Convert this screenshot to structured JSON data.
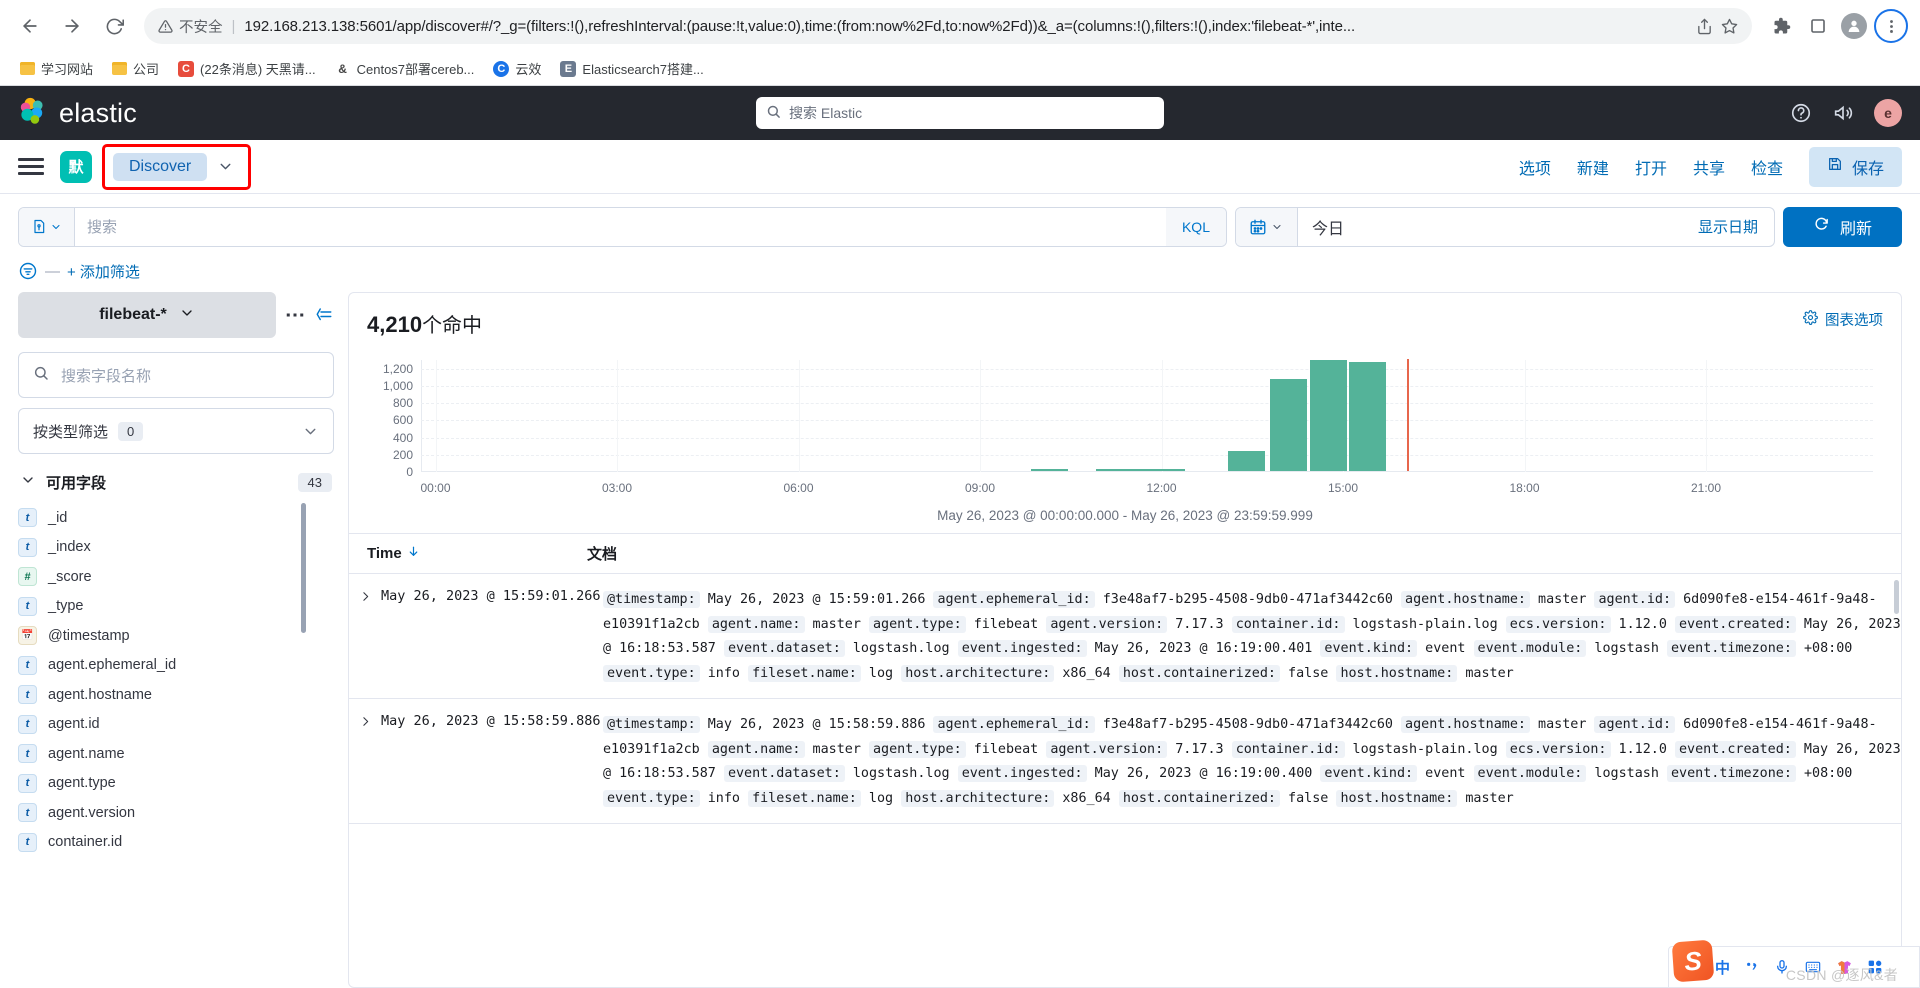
{
  "browser": {
    "back_icon": "back-arrow-icon",
    "forward_icon": "forward-arrow-icon",
    "reload_icon": "reload-icon",
    "insecure_label": "不安全",
    "url": "192.168.213.138:5601/app/discover#/?_g=(filters:!(),refreshInterval:(pause:!t,value:0),time:(from:now%2Fd,to:now%2Fd))&_a=(columns:!(),filters:!(),index:'filebeat-*',inte...",
    "bookmarks": [
      {
        "label": "学习网站",
        "type": "folder"
      },
      {
        "label": "公司",
        "type": "folder"
      },
      {
        "label": "(22条消息) 天黑请...",
        "type": "favicon",
        "glyph": "C",
        "color": "#e74c3c"
      },
      {
        "label": "Centos7部署cereb...",
        "type": "favicon",
        "glyph": "&",
        "color": "#ffffff"
      },
      {
        "label": "云效",
        "type": "favicon",
        "glyph": "C",
        "color": "#1a73e8"
      },
      {
        "label": "Elasticsearch7搭建...",
        "type": "favicon",
        "glyph": "E",
        "color": "#6b7a8f"
      }
    ]
  },
  "elastic_header": {
    "wordmark": "elastic",
    "search_placeholder": "搜索 Elastic",
    "search_icon": "search-icon",
    "help_icon": "help-circle-icon",
    "news_icon": "announcement-icon",
    "avatar_initial": "e"
  },
  "app_nav": {
    "menu_icon": "hamburger-menu-icon",
    "space_initial": "默",
    "current_app": "Discover",
    "chevron_icon": "chevron-down-icon",
    "links": [
      "选项",
      "新建",
      "打开",
      "共享",
      "检查"
    ],
    "save_label": "保存",
    "save_icon": "save-disk-icon",
    "highlight_color": "#ff0000"
  },
  "query_bar": {
    "saved_query_icon": "saved-query-icon",
    "search_placeholder": "搜索",
    "language_badge": "KQL",
    "calendar_icon": "calendar-icon",
    "date_value": "今日",
    "show_dates_label": "显示日期",
    "refresh_label": "刷新",
    "refresh_icon": "refresh-icon"
  },
  "filter_bar": {
    "filter_icon": "filter-icon",
    "dash": "—",
    "add_filter_label": "+ 添加筛选"
  },
  "sidebar": {
    "index_pattern": "filebeat-*",
    "index_chevron_icon": "chevron-down-icon",
    "more_icon": "more-horizontal-icon",
    "collapse_icon": "collapse-sidebar-icon",
    "field_search_placeholder": "搜索字段名称",
    "field_search_icon": "search-icon",
    "type_filter_label": "按类型筛选",
    "type_filter_count": "0",
    "available_fields_label": "可用字段",
    "available_fields_count": "43",
    "fields": [
      {
        "name": "_id",
        "type": "t"
      },
      {
        "name": "_index",
        "type": "t"
      },
      {
        "name": "_score",
        "type": "#"
      },
      {
        "name": "_type",
        "type": "t"
      },
      {
        "name": "@timestamp",
        "type": "date"
      },
      {
        "name": "agent.ephemeral_id",
        "type": "t"
      },
      {
        "name": "agent.hostname",
        "type": "t"
      },
      {
        "name": "agent.id",
        "type": "t"
      },
      {
        "name": "agent.name",
        "type": "t"
      },
      {
        "name": "agent.type",
        "type": "t"
      },
      {
        "name": "agent.version",
        "type": "t"
      },
      {
        "name": "container.id",
        "type": "t"
      }
    ]
  },
  "chart_panel": {
    "hits_count": "4,210",
    "hits_suffix": "个命中",
    "chart_options_label": "图表选项",
    "chart_options_icon": "gear-icon"
  },
  "chart_data": {
    "type": "bar",
    "title": "4,210 个命中",
    "xlabel": "",
    "ylabel": "",
    "ylim": [
      0,
      1300
    ],
    "yticks": [
      0,
      200,
      400,
      600,
      800,
      1000,
      1200
    ],
    "ytick_labels": [
      "0",
      "200",
      "400",
      "600",
      "800",
      "1,000",
      "1,200"
    ],
    "xticks": [
      "00:00",
      "03:00",
      "06:00",
      "09:00",
      "12:00",
      "15:00",
      "18:00",
      "21:00"
    ],
    "x_range_label": "May 26, 2023 @ 00:00:00.000 - May 26, 2023 @ 23:59:59.999",
    "grid": true,
    "bar_color": "#54b399",
    "marker_color": "#e7664c",
    "marker_label": "now",
    "categories": [
      "10:00",
      "11:00",
      "11:30",
      "12:00",
      "13:30",
      "14:00",
      "14:30",
      "15:00",
      "15:30"
    ],
    "values": [
      25,
      22,
      20,
      22,
      235,
      1070,
      1290,
      1265,
      0
    ],
    "bars": [
      {
        "x_pct": 42.0,
        "value": 25
      },
      {
        "x_pct": 46.5,
        "value": 22
      },
      {
        "x_pct": 48.3,
        "value": 20
      },
      {
        "x_pct": 50.1,
        "value": 22
      },
      {
        "x_pct": 55.6,
        "value": 235
      },
      {
        "x_pct": 58.5,
        "value": 1070
      },
      {
        "x_pct": 61.2,
        "value": 1290
      },
      {
        "x_pct": 63.9,
        "value": 1265
      }
    ],
    "now_marker_pct": 67.9
  },
  "doc_table": {
    "time_header": "Time",
    "sort_icon": "sort-desc-arrow-icon",
    "doc_header": "文档",
    "expand_icon": "chevron-right-icon",
    "rows": [
      {
        "time": "May 26, 2023 @ 15:59:01.266",
        "pairs": [
          {
            "k": "@timestamp:",
            "v": "May 26, 2023 @ 15:59:01.266"
          },
          {
            "k": "agent.ephemeral_id:",
            "v": "f3e48af7-b295-4508-9db0-471af3442c60"
          },
          {
            "k": "agent.hostname:",
            "v": "master"
          },
          {
            "k": "agent.id:",
            "v": "6d090fe8-e154-461f-9a48-e10391f1a2cb"
          },
          {
            "k": "agent.name:",
            "v": "master"
          },
          {
            "k": "agent.type:",
            "v": "filebeat"
          },
          {
            "k": "agent.version:",
            "v": "7.17.3"
          },
          {
            "k": "container.id:",
            "v": "logstash-plain.log"
          },
          {
            "k": "ecs.version:",
            "v": "1.12.0"
          },
          {
            "k": "event.created:",
            "v": "May 26, 2023 @ 16:18:53.587"
          },
          {
            "k": "event.dataset:",
            "v": "logstash.log"
          },
          {
            "k": "event.ingested:",
            "v": "May 26, 2023 @ 16:19:00.401"
          },
          {
            "k": "event.kind:",
            "v": "event"
          },
          {
            "k": "event.module:",
            "v": "logstash"
          },
          {
            "k": "event.timezone:",
            "v": "+08:00"
          },
          {
            "k": "event.type:",
            "v": "info"
          },
          {
            "k": "fileset.name:",
            "v": "log"
          },
          {
            "k": "host.architecture:",
            "v": "x86_64"
          },
          {
            "k": "host.containerized:",
            "v": "false"
          },
          {
            "k": "host.hostname:",
            "v": "master"
          }
        ]
      },
      {
        "time": "May 26, 2023 @ 15:58:59.886",
        "pairs": [
          {
            "k": "@timestamp:",
            "v": "May 26, 2023 @ 15:58:59.886"
          },
          {
            "k": "agent.ephemeral_id:",
            "v": "f3e48af7-b295-4508-9db0-471af3442c60"
          },
          {
            "k": "agent.hostname:",
            "v": "master"
          },
          {
            "k": "agent.id:",
            "v": "6d090fe8-e154-461f-9a48-e10391f1a2cb"
          },
          {
            "k": "agent.name:",
            "v": "master"
          },
          {
            "k": "agent.type:",
            "v": "filebeat"
          },
          {
            "k": "agent.version:",
            "v": "7.17.3"
          },
          {
            "k": "container.id:",
            "v": "logstash-plain.log"
          },
          {
            "k": "ecs.version:",
            "v": "1.12.0"
          },
          {
            "k": "event.created:",
            "v": "May 26, 2023 @ 16:18:53.587"
          },
          {
            "k": "event.dataset:",
            "v": "logstash.log"
          },
          {
            "k": "event.ingested:",
            "v": "May 26, 2023 @ 16:19:00.400"
          },
          {
            "k": "event.kind:",
            "v": "event"
          },
          {
            "k": "event.module:",
            "v": "logstash"
          },
          {
            "k": "event.timezone:",
            "v": "+08:00"
          },
          {
            "k": "event.type:",
            "v": "info"
          },
          {
            "k": "fileset.name:",
            "v": "log"
          },
          {
            "k": "host.architecture:",
            "v": "x86_64"
          },
          {
            "k": "host.containerized:",
            "v": "false"
          },
          {
            "k": "host.hostname:",
            "v": "master"
          }
        ]
      }
    ]
  },
  "ime": {
    "logo_glyph": "S",
    "mode_label": "中",
    "punct_icon": "punctuation-icon",
    "mic_icon": "microphone-icon",
    "keyboard_icon": "keyboard-icon",
    "skin_icon": "skin-tshirt-icon",
    "toolbox_icon": "toolbox-icon"
  },
  "watermark": "CSDN @逐风&者"
}
